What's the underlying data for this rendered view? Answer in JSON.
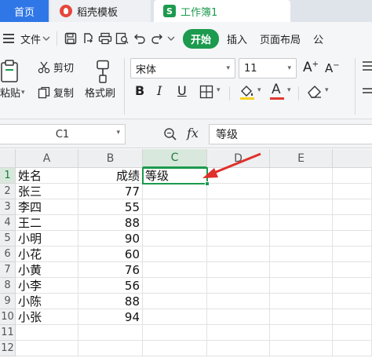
{
  "tabs": {
    "home": "首页",
    "docer": "稻壳模板",
    "workbook": "工作簿1",
    "workbook_icon": "S"
  },
  "menu": {
    "file": "文件",
    "start": "开始",
    "insert": "插入",
    "layout": "页面布局",
    "formula_partial": "公"
  },
  "ribbon": {
    "paste": "粘贴",
    "cut": "剪切",
    "copy": "复制",
    "format_painter": "格式刷",
    "font_name": "宋体",
    "font_size": "11",
    "bold": "B",
    "italic": "I",
    "underline": "U",
    "font_color_letter": "A",
    "accent_color": "#1c9a4e",
    "font_color_bar": "#e23a2e",
    "fill_color_bar": "#f5d21c"
  },
  "formula_bar": {
    "cell_ref": "C1",
    "fx": "fx",
    "content": "等级"
  },
  "sheet": {
    "columns": [
      "A",
      "B",
      "C",
      "D",
      "E"
    ],
    "rows": [
      "1",
      "2",
      "3",
      "4",
      "5",
      "6",
      "7",
      "8",
      "9",
      "10",
      "11",
      "12"
    ],
    "data": [
      {
        "a": "姓名",
        "b": "成绩",
        "c": "等级"
      },
      {
        "a": "张三",
        "b": "77"
      },
      {
        "a": "李四",
        "b": "55"
      },
      {
        "a": "王二",
        "b": "88"
      },
      {
        "a": "小明",
        "b": "90"
      },
      {
        "a": "小花",
        "b": "60"
      },
      {
        "a": "小黄",
        "b": "76"
      },
      {
        "a": "小李",
        "b": "56"
      },
      {
        "a": "小陈",
        "b": "88"
      },
      {
        "a": "小张",
        "b": "94"
      }
    ]
  }
}
